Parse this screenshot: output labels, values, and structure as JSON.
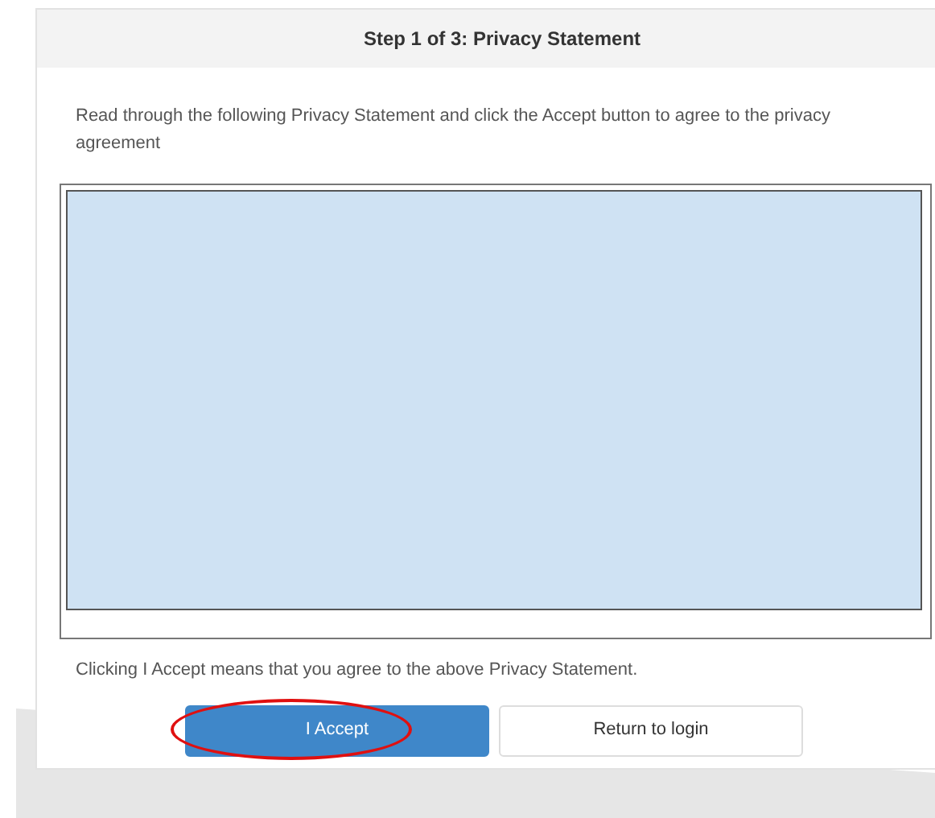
{
  "header": {
    "title": "Step 1 of 3: Privacy Statement"
  },
  "instructions": "Read through the following Privacy Statement and click the Accept button to agree to the privacy agreement",
  "agreement_note": "Clicking I Accept means that you agree to the above Privacy Statement.",
  "buttons": [
    {
      "label": "I Accept",
      "kind": "primary",
      "highlighted": true
    },
    {
      "label": "Return to login",
      "kind": "secondary",
      "highlighted": false
    }
  ]
}
